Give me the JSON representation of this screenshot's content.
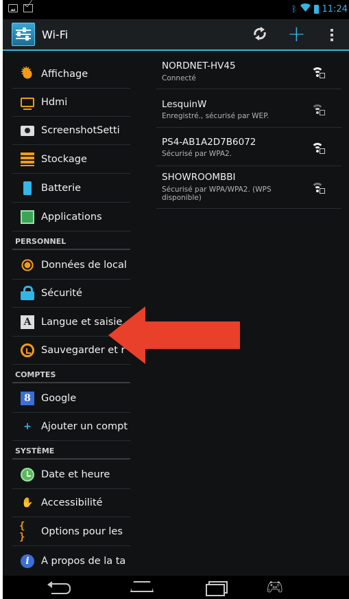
{
  "status_bar": {
    "time": "11:24"
  },
  "action_bar": {
    "title": "Wi-Fi",
    "refresh_icon": "refresh-icon",
    "add_icon": "add-network-icon",
    "overflow_icon": "overflow-menu-icon"
  },
  "settings": {
    "items_top": [
      {
        "label": "Affichage",
        "icon": "display-sun-icon"
      },
      {
        "label": "Hdmi",
        "icon": "hdmi-monitor-icon"
      },
      {
        "label": "ScreenshotSetti",
        "icon": "camera-icon"
      },
      {
        "label": "Stockage",
        "icon": "storage-icon"
      },
      {
        "label": "Batterie",
        "icon": "battery-icon"
      },
      {
        "label": "Applications",
        "icon": "applications-icon"
      }
    ],
    "header_personnel": "PERSONNEL",
    "items_personnel": [
      {
        "label": "Données de local",
        "icon": "location-icon"
      },
      {
        "label": "Sécurité",
        "icon": "lock-icon"
      },
      {
        "label": "Langue et saisie",
        "icon": "language-icon"
      },
      {
        "label": "Sauvegarder et r",
        "icon": "backup-icon"
      }
    ],
    "header_comptes": "COMPTES",
    "items_comptes": [
      {
        "label": "Google",
        "icon": "google-icon"
      },
      {
        "label": "Ajouter un compt",
        "icon": "plus-icon"
      }
    ],
    "header_systeme": "SYSTÈME",
    "items_systeme": [
      {
        "label": "Date et heure",
        "icon": "clock-icon"
      },
      {
        "label": "Accessibilité",
        "icon": "hand-icon"
      },
      {
        "label": "Options pour les",
        "icon": "braces-icon"
      },
      {
        "label": "À propos de la ta",
        "icon": "info-icon"
      }
    ]
  },
  "wifi_networks": [
    {
      "ssid": "NORDNET-HV45",
      "status": "Connecté"
    },
    {
      "ssid": "LesquinW",
      "status": "Enregistré., sécurisé par WEP."
    },
    {
      "ssid": "PS4-AB1A2D7B6072",
      "status": "Sécurisé par WPA2."
    },
    {
      "ssid": "SHOWROOMBBI",
      "status": "Sécurisé par WPA/WPA2. (WPS disponible)"
    }
  ],
  "annotation": {
    "arrow_color": "#e8402b",
    "icon": "red-arrow-annotation"
  },
  "colors": {
    "accent": "#33b5e5",
    "orange": "#f39c12",
    "background": "#101214"
  }
}
